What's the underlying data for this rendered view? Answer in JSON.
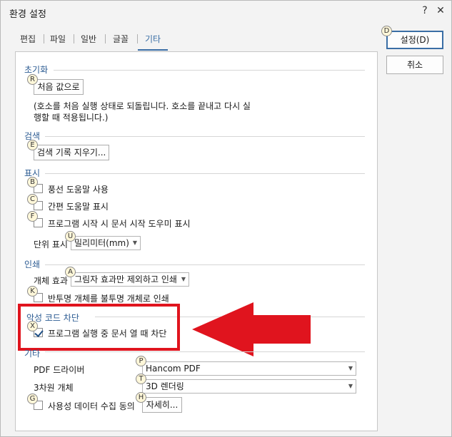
{
  "window": {
    "title": "환경 설정",
    "help_glyph": "?",
    "close_glyph": "✕"
  },
  "tabs": [
    "편집",
    "파일",
    "일반",
    "글꼴",
    "기타"
  ],
  "active_tab": "기타",
  "side": {
    "ok_label": "설정(D)",
    "ok_key": "D",
    "cancel_label": "취소"
  },
  "reset": {
    "title": "초기화",
    "button": "처음 값으로",
    "key": "R",
    "desc1": "(호소를 처음 실행 상태로 되돌립니다. 호소를 끝내고 다시 실",
    "desc2": "행할 때 적용됩니다.)"
  },
  "search": {
    "title": "검색",
    "button": "검색 기록 지우기...",
    "key": "E"
  },
  "display": {
    "title": "표시",
    "items": [
      {
        "label": "풍선 도움말 사용",
        "key": "B",
        "checked": false
      },
      {
        "label": "간편 도움말 표시",
        "key": "C",
        "checked": false
      },
      {
        "label": "프로그램 시작 시 문서 시작 도우미 표시",
        "key": "F",
        "checked": false
      }
    ],
    "unit_label": "단위 표시",
    "unit_key": "U",
    "unit_value": "밀리미터(mm)"
  },
  "print": {
    "title": "인쇄",
    "object_label": "개체 효과",
    "object_key": "A",
    "object_value": "그림자 효과만 제외하고 인쇄",
    "semi_label": "반투명 개체를 불투명 개체로 인쇄",
    "semi_key": "K"
  },
  "malware": {
    "title": "악성 코드 차단",
    "label": "프로그램 실행 중 문서 열 때 차단",
    "key": "X",
    "checked": true
  },
  "etc": {
    "title": "기타",
    "pdf_label": "PDF 드라이버",
    "pdf_key": "P",
    "pdf_value": "Hancom PDF",
    "threed_label": "3차원 개체",
    "threed_key": "T",
    "threed_value": "3D 렌더링",
    "usage_label": "사용성 데이터 수집 동의",
    "usage_key": "G",
    "detail_button": "자세히...",
    "detail_key": "H"
  },
  "colors": {
    "accent": "#3a6ea5",
    "highlight": "#e0141e"
  }
}
